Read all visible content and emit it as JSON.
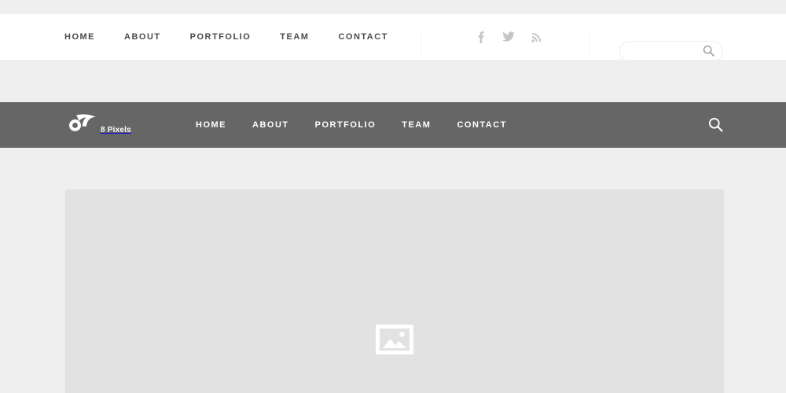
{
  "theme": {
    "page_bg": "#efefef",
    "utility_bar_bg": "#ffffff",
    "main_nav_bg": "#666666",
    "placeholder_bg": "#e2e2e2",
    "utility_link_color": "#4a4a4a",
    "main_link_color": "#ffffff",
    "social_icon_color": "#c6c6c6"
  },
  "utility_bar": {
    "nav": [
      {
        "label": "HOME"
      },
      {
        "label": "ABOUT"
      },
      {
        "label": "PORTFOLIO"
      },
      {
        "label": "TEAM"
      },
      {
        "label": "CONTACT"
      }
    ],
    "social": [
      {
        "name": "facebook",
        "label": "Facebook"
      },
      {
        "name": "twitter",
        "label": "Twitter"
      },
      {
        "name": "rss",
        "label": "RSS"
      }
    ],
    "search": {
      "value": "",
      "placeholder": "",
      "icon": "search-icon"
    }
  },
  "main_nav": {
    "brand": {
      "text": "8 Pixels",
      "mark": "ring-and-petal-logo"
    },
    "nav": [
      {
        "label": "HOME"
      },
      {
        "label": "ABOUT"
      },
      {
        "label": "PORTFOLIO"
      },
      {
        "label": "TEAM"
      },
      {
        "label": "CONTACT"
      }
    ],
    "search_icon": "search-icon"
  },
  "content": {
    "placeholder": {
      "icon": "image-placeholder-icon",
      "label": ""
    }
  }
}
